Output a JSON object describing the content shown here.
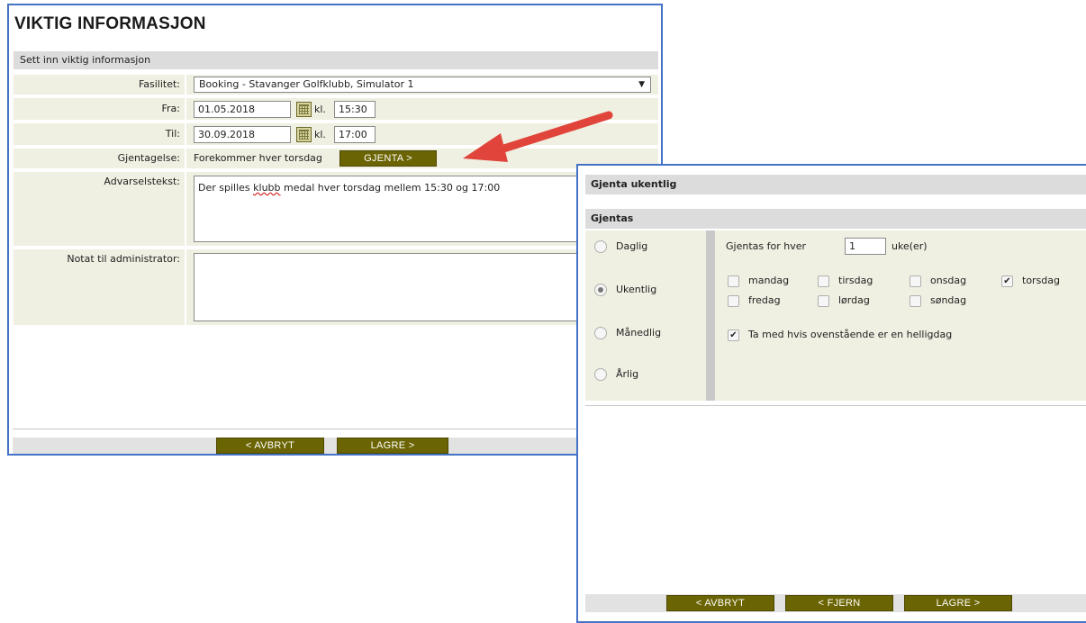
{
  "main": {
    "title": "VIKTIG INFORMASJON",
    "section": "Sett inn viktig informasjon",
    "fasilitet_label": "Fasilitet:",
    "fasilitet_value": "Booking - Stavanger Golfklubb, Simulator 1",
    "fra_label": "Fra:",
    "fra_date": "01.05.2018",
    "fra_time": "15:30",
    "til_label": "Til:",
    "til_date": "30.09.2018",
    "til_time": "17:00",
    "kl_label": "kl.",
    "gjentagelse_label": "Gjentagelse:",
    "gjentagelse_value": "Forekommer hver torsdag",
    "gjenta_button": "GJENTA >",
    "advarsel_label": "Advarselstekst:",
    "advarsel_text_pre": "Der spilles ",
    "advarsel_text_misspelled": "klubb",
    "advarsel_text_post": " medal hver torsdag mellem 15:30 og 17:00",
    "notat_label": "Notat til administrator:",
    "notat_text": "",
    "cancel_button": "< AVBRYT",
    "save_button": "LAGRE >"
  },
  "dialog": {
    "title": "Gjenta ukentlig",
    "section": "Gjentas",
    "options": [
      "Daglig",
      "Ukentlig",
      "Månedlig",
      "Årlig"
    ],
    "selected_option": "Ukentlig",
    "repeat_every_label": "Gjentas for hver",
    "repeat_every_value": "1",
    "repeat_unit": "uke(er)",
    "days": [
      {
        "label": "mandag",
        "checked": false
      },
      {
        "label": "tirsdag",
        "checked": false
      },
      {
        "label": "onsdag",
        "checked": false
      },
      {
        "label": "torsdag",
        "checked": true
      },
      {
        "label": "fredag",
        "checked": false
      },
      {
        "label": "lørdag",
        "checked": false
      },
      {
        "label": "søndag",
        "checked": false
      }
    ],
    "include_holidays_label": "Ta med hvis ovenstående er en helligdag",
    "include_holidays_checked": true,
    "cancel_button": "< AVBRYT",
    "remove_button": "< FJERN",
    "save_button": "LAGRE >"
  },
  "colors": {
    "button": "#6b6403",
    "row_bg": "#efefe2",
    "window_border": "#4472c4",
    "arrow": "#e0443a"
  }
}
